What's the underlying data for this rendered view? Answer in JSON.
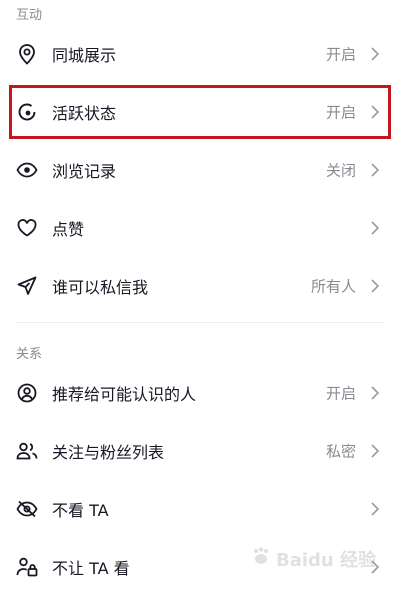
{
  "sections": {
    "interaction": {
      "title": "互动"
    },
    "relations": {
      "title": "关系"
    }
  },
  "rows": [
    {
      "icon": "location-pin-icon",
      "label": "同城展示",
      "value": "开启"
    },
    {
      "icon": "activity-status-icon",
      "label": "活跃状态",
      "value": "开启"
    },
    {
      "icon": "eye-icon",
      "label": "浏览记录",
      "value": "关闭"
    },
    {
      "icon": "heart-icon",
      "label": "点赞",
      "value": ""
    },
    {
      "icon": "paper-plane-icon",
      "label": "谁可以私信我",
      "value": "所有人"
    },
    {
      "icon": "person-circle-icon",
      "label": "推荐给可能认识的人",
      "value": "开启"
    },
    {
      "icon": "people-icon",
      "label": "关注与粉丝列表",
      "value": "私密"
    },
    {
      "icon": "eye-slash-icon",
      "label": "不看 TA",
      "value": ""
    },
    {
      "icon": "person-lock-icon",
      "label": "不让 TA 看",
      "value": ""
    }
  ],
  "highlight_color": "#c4161c",
  "watermark": {
    "text": "Baidu 经验"
  }
}
